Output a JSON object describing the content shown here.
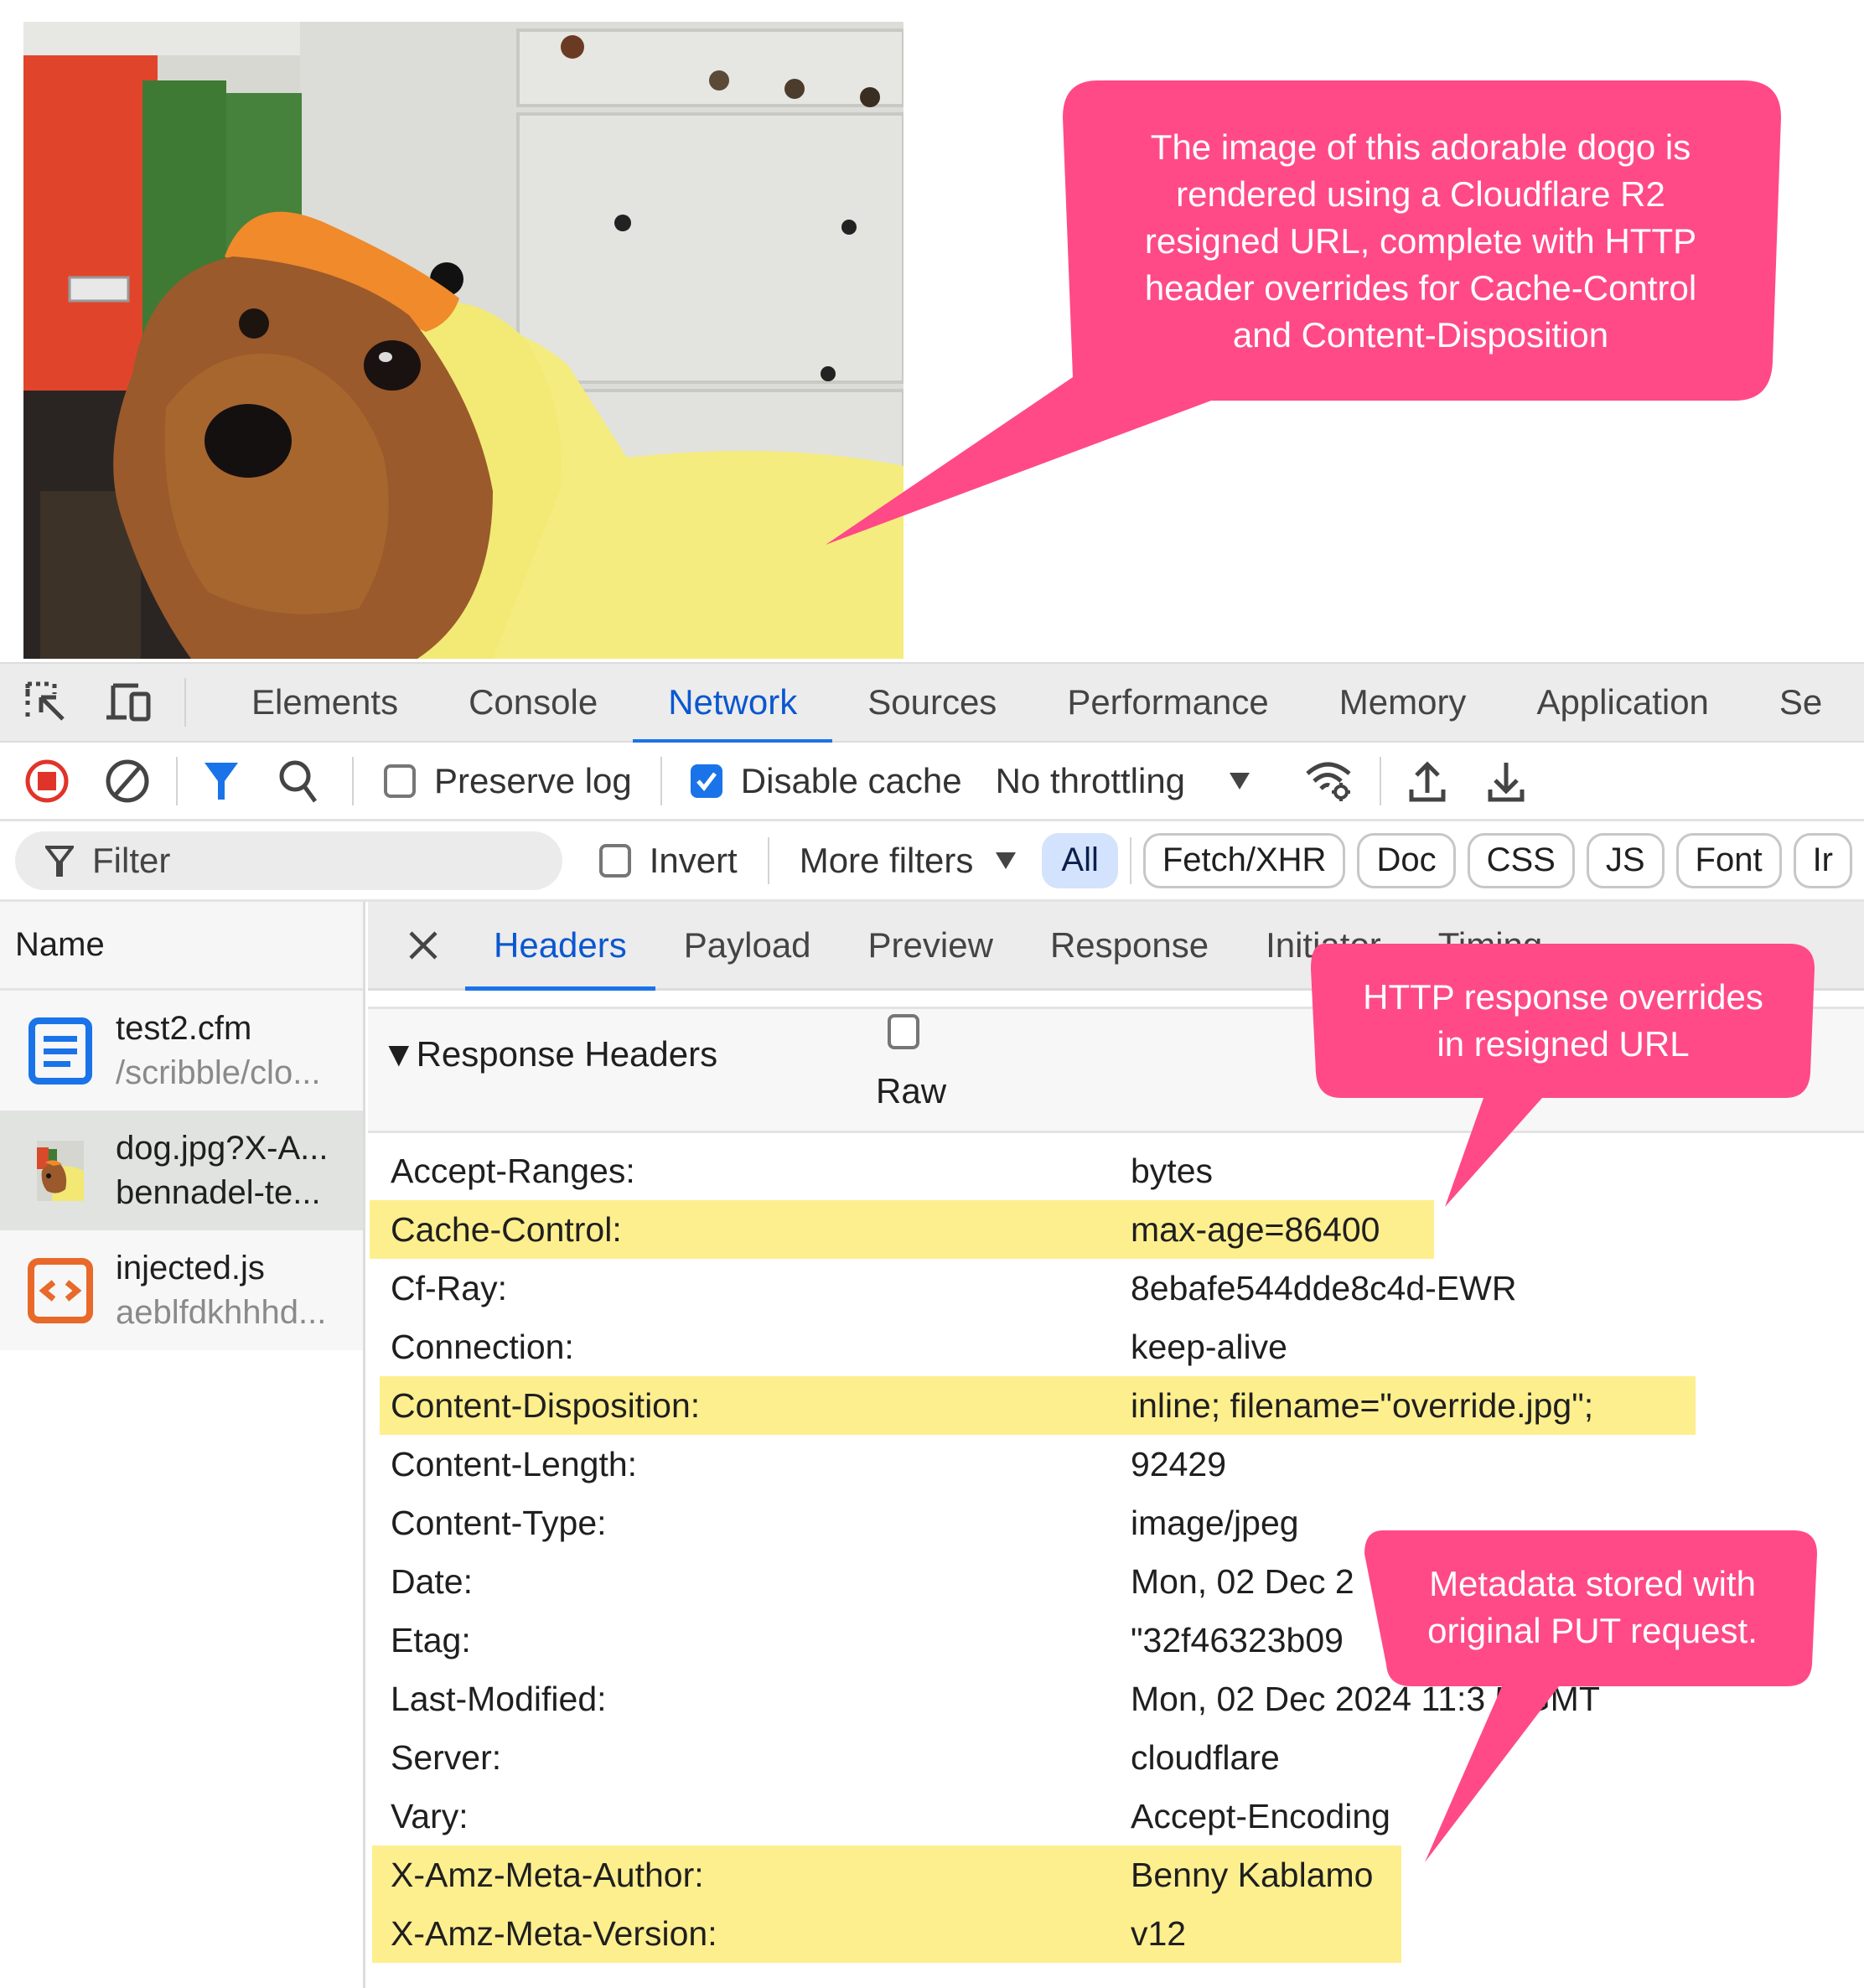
{
  "photo": {
    "alt": "Small Yorkshire terrier dog wearing a yellow duck costume with orange bill"
  },
  "devtools": {
    "main_tabs": [
      {
        "label": "Elements",
        "active": false
      },
      {
        "label": "Console",
        "active": false
      },
      {
        "label": "Network",
        "active": true
      },
      {
        "label": "Sources",
        "active": false
      },
      {
        "label": "Performance",
        "active": false
      },
      {
        "label": "Memory",
        "active": false
      },
      {
        "label": "Application",
        "active": false
      },
      {
        "label": "Se",
        "active": false
      }
    ],
    "toolbar": {
      "preserve_log": {
        "label": "Preserve log",
        "checked": false
      },
      "disable_cache": {
        "label": "Disable cache",
        "checked": true
      },
      "throttling": {
        "selected": "No throttling"
      }
    },
    "filter_bar": {
      "filter_placeholder": "Filter",
      "invert": {
        "label": "Invert",
        "checked": false
      },
      "more_filters": "More filters",
      "type_filters": [
        {
          "label": "All",
          "active": true
        },
        {
          "label": "Fetch/XHR",
          "active": false
        },
        {
          "label": "Doc",
          "active": false
        },
        {
          "label": "CSS",
          "active": false
        },
        {
          "label": "JS",
          "active": false
        },
        {
          "label": "Font",
          "active": false
        },
        {
          "label": "Ir",
          "active": false
        }
      ]
    },
    "request_list": {
      "header": "Name",
      "rows": [
        {
          "name": "test2.cfm",
          "sub": "/scribble/clo...",
          "icon": "document-icon",
          "selected": false
        },
        {
          "name": "dog.jpg?X-A...",
          "sub": "bennadel-te...",
          "icon": "image-thumbnail",
          "selected": true
        },
        {
          "name": "injected.js",
          "sub": "aeblfdkhhhd...",
          "icon": "script-icon",
          "selected": false
        }
      ]
    },
    "details": {
      "tabs": [
        {
          "label": "Headers",
          "active": true
        },
        {
          "label": "Payload",
          "active": false
        },
        {
          "label": "Preview",
          "active": false
        },
        {
          "label": "Response",
          "active": false
        },
        {
          "label": "Initiator",
          "active": false
        },
        {
          "label": "Timing",
          "active": false
        }
      ],
      "section_title": "▼Response Headers",
      "raw_label": "Raw",
      "raw_checked": false,
      "headers": [
        {
          "name": "Accept-Ranges:",
          "value": "bytes",
          "highlighted": false
        },
        {
          "name": "Cache-Control:",
          "value": "max-age=86400",
          "highlighted": true
        },
        {
          "name": "Cf-Ray:",
          "value": "8ebafe544dde8c4d-EWR",
          "highlighted": false
        },
        {
          "name": "Connection:",
          "value": "keep-alive",
          "highlighted": false
        },
        {
          "name": "Content-Disposition:",
          "value": "inline; filename=\"override.jpg\";",
          "highlighted": true
        },
        {
          "name": "Content-Length:",
          "value": "92429",
          "highlighted": false
        },
        {
          "name": "Content-Type:",
          "value": "image/jpeg",
          "highlighted": false
        },
        {
          "name": "Date:",
          "value": "Mon, 02 Dec 2",
          "highlighted": false
        },
        {
          "name": "Etag:",
          "value": "\"32f46323b09",
          "highlighted": false
        },
        {
          "name": "Last-Modified:",
          "value": "Mon, 02 Dec 2024 11:3  5 GMT",
          "highlighted": false
        },
        {
          "name": "Server:",
          "value": "cloudflare",
          "highlighted": false
        },
        {
          "name": "Vary:",
          "value": "Accept-Encoding",
          "highlighted": false
        },
        {
          "name": "X-Amz-Meta-Author:",
          "value": "Benny Kablamo",
          "highlighted": true
        },
        {
          "name": "X-Amz-Meta-Version:",
          "value": "v12",
          "highlighted": true
        }
      ]
    }
  },
  "callouts": {
    "color": "#ff4a87",
    "highlight_color": "#fdef8e",
    "items": [
      {
        "text": "The image of this adorable dogo is\nrendered using a Cloudflare R2\nresigned URL, complete with HTTP\nheader overrides for Cache-Control\nand Content-Disposition"
      },
      {
        "text": "HTTP response overrides\nin resigned URL"
      },
      {
        "text": "Metadata stored with\noriginal PUT request."
      }
    ]
  }
}
